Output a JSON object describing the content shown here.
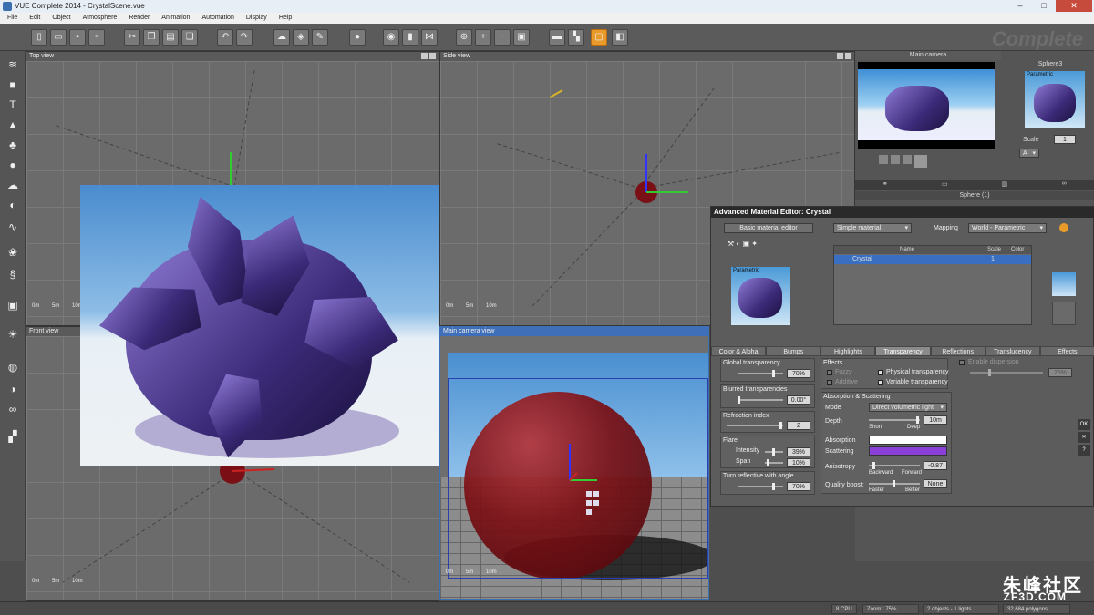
{
  "window": {
    "title": "VUE Complete 2014 - CrystalScene.vue",
    "buttons": [
      "–",
      "□",
      "✕"
    ]
  },
  "menu": [
    "File",
    "Edit",
    "Object",
    "Atmosphere",
    "Render",
    "Animation",
    "Automation",
    "Display",
    "Help"
  ],
  "brand_watermark": "Complete",
  "viewports": {
    "top": {
      "title": "Top view",
      "scale": [
        "0m",
        "5m",
        "10m"
      ]
    },
    "side": {
      "title": "Side view",
      "scale": [
        "0m",
        "5m",
        "10m"
      ]
    },
    "front": {
      "title": "Front view",
      "scale": [
        "0m",
        "5m",
        "10m"
      ]
    },
    "camera": {
      "title": "Main camera view",
      "scale": [
        "0m",
        "5m",
        "10m"
      ]
    }
  },
  "right_panel": {
    "camera_title": "Main camera",
    "object_name": "Sphere3",
    "material_label": "Parametric",
    "scale_label": "Scale",
    "scale_value": "1",
    "a_select": "A",
    "object_list_title": "Sphere (1)"
  },
  "ame": {
    "title": "Advanced Material Editor: Crystal",
    "basic_button": "Basic material editor",
    "material_type": "Simple material",
    "mapping_label": "Mapping",
    "mapping_value": "World - Parametric",
    "preview_label": "Parametric",
    "layer_columns": [
      "Name",
      "Scale",
      "Color"
    ],
    "layer_row": {
      "name": "Crystal",
      "scale": "1"
    },
    "tabs": [
      "Color & Alpha",
      "Bumps",
      "Highlights",
      "Transparency",
      "Reflections",
      "Translucency",
      "Effects"
    ],
    "active_tab": "Transparency",
    "global_transparency": {
      "label": "Global transparency",
      "value": "70%"
    },
    "blurred": {
      "label": "Blurred transparencies",
      "value": "0.00°"
    },
    "refraction": {
      "label": "Refraction index",
      "value": "2"
    },
    "flare": {
      "label": "Flare",
      "intensity_label": "Intensity",
      "intensity": "39%",
      "span_label": "Span",
      "span": "10%"
    },
    "turn_reflective": {
      "label": "Turn reflective with angle",
      "value": "70%"
    },
    "effects": {
      "label": "Effects",
      "fuzzy": "Fuzzy",
      "additive": "Additive",
      "physical": "Physical transparency",
      "variable": "Variable transparency"
    },
    "dispersion": {
      "label": "Enable dispersion",
      "value": "25%"
    },
    "absorption": {
      "label": "Absorption & Scattering",
      "mode_label": "Mode",
      "mode_value": "Direct volumetric light",
      "depth_label": "Depth",
      "depth_value": "10m",
      "short": "Short",
      "deep": "Deep",
      "absorption_label": "Absorption",
      "absorption_color": "#ffffff",
      "scattering_label": "Scattering",
      "scattering_color": "#8a3fd8",
      "anisotropy_label": "Anisotropy",
      "anisotropy_value": "-0.87",
      "backward": "Backward",
      "forward": "Forward",
      "quality_label": "Quality boost:",
      "quality_value": "None",
      "faster": "Faster",
      "better": "Better"
    },
    "side_buttons": [
      "OK",
      "✕",
      "?"
    ]
  },
  "status": {
    "cpu": "8 CPU",
    "zoom": "Zoom : 75%",
    "objects": "2 objects - 1 lights",
    "polygons": "32,684 polygons"
  },
  "watermark": {
    "main": "朱峰社区",
    "sub": "ZF3D.COM"
  }
}
